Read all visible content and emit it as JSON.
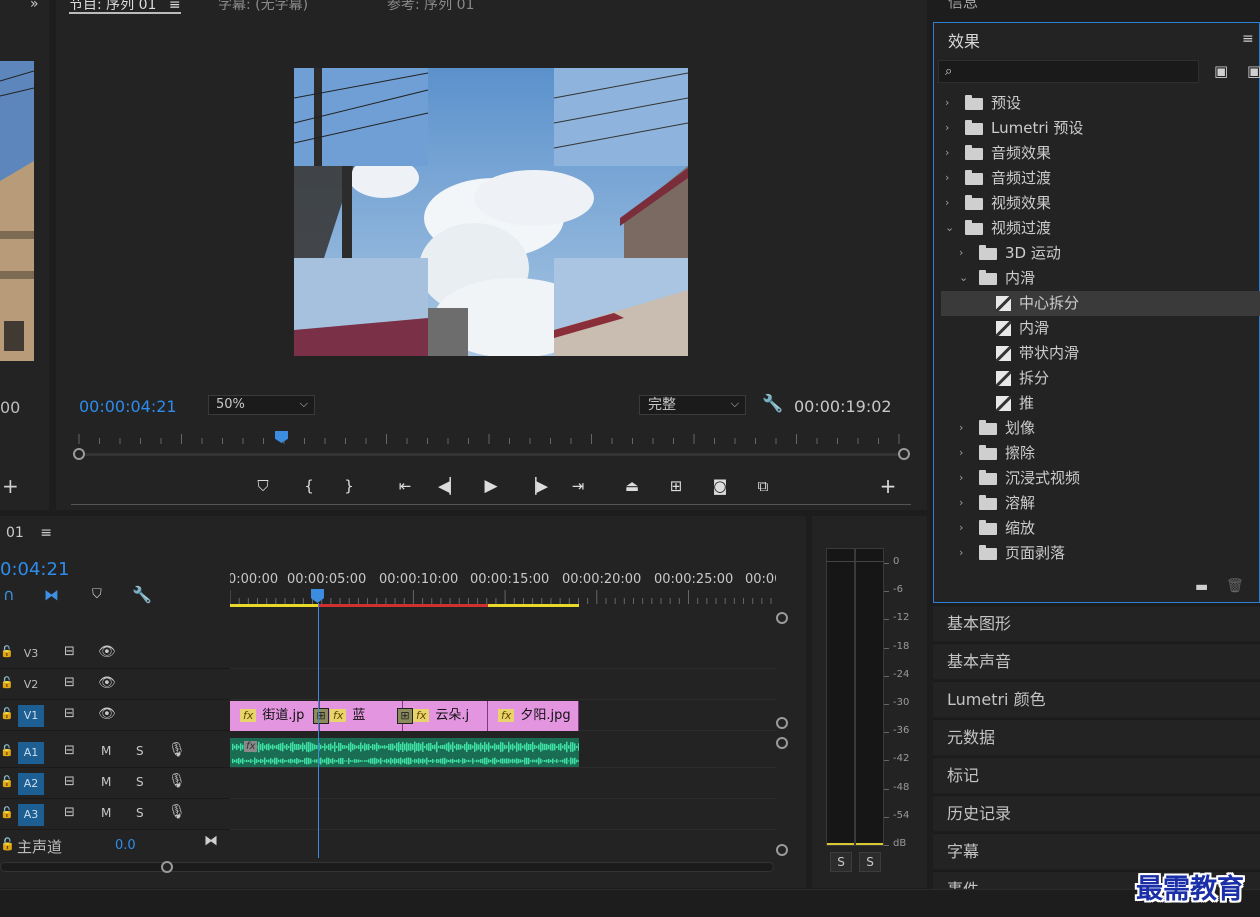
{
  "source_monitor": {
    "timecode_partial": "00"
  },
  "program_monitor": {
    "tabs": [
      "节目: 序列 01",
      "字幕: (无字幕)",
      "参考: 序列 01"
    ],
    "current_time": "00:00:04:21",
    "zoom": "50%",
    "quality": "完整",
    "duration": "00:00:19:02",
    "playhead_fraction": 0.25
  },
  "timeline": {
    "sequence_tab": "01",
    "current_time": "0:04:21",
    "ruler": [
      "0:00:00",
      "00:00:05:00",
      "00:00:10:00",
      "00:00:15:00",
      "00:00:20:00",
      "00:00:25:00",
      "00:00:"
    ],
    "tracks": [
      {
        "label": "V3"
      },
      {
        "label": "V2"
      },
      {
        "label": "V1",
        "m": "",
        "s": ""
      },
      {
        "label": "A1",
        "m": "M",
        "s": "S"
      },
      {
        "label": "A2",
        "m": "M",
        "s": "S"
      },
      {
        "label": "A3",
        "m": "M",
        "s": "S"
      }
    ],
    "master": {
      "label": "主声道",
      "value": "0.0"
    },
    "clips": [
      {
        "name": "街道.jp"
      },
      {
        "name": "蓝"
      },
      {
        "name": "云朵.j"
      },
      {
        "name": "夕阳.jpg"
      }
    ],
    "fx_badge": "fx"
  },
  "audio_meter": {
    "scale": [
      "0",
      "-6",
      "-12",
      "-18",
      "-24",
      "-30",
      "-36",
      "-42",
      "-48",
      "-54",
      "dB"
    ],
    "solo": [
      "S",
      "S"
    ]
  },
  "effects_panel": {
    "title": "效果",
    "search_placeholder": "",
    "tree": [
      {
        "label": "预设",
        "level": 0,
        "kind": "preset-folder",
        "expanded": false
      },
      {
        "label": "Lumetri 预设",
        "level": 0,
        "kind": "preset-folder",
        "expanded": false
      },
      {
        "label": "音频效果",
        "level": 0,
        "kind": "folder",
        "expanded": false
      },
      {
        "label": "音频过渡",
        "level": 0,
        "kind": "folder",
        "expanded": false
      },
      {
        "label": "视频效果",
        "level": 0,
        "kind": "folder",
        "expanded": false
      },
      {
        "label": "视频过渡",
        "level": 0,
        "kind": "folder",
        "expanded": true
      },
      {
        "label": "3D 运动",
        "level": 1,
        "kind": "folder",
        "expanded": false
      },
      {
        "label": "内滑",
        "level": 1,
        "kind": "folder",
        "expanded": true
      },
      {
        "label": "中心拆分",
        "level": 2,
        "kind": "transition",
        "selected": true
      },
      {
        "label": "内滑",
        "level": 2,
        "kind": "transition"
      },
      {
        "label": "带状内滑",
        "level": 2,
        "kind": "transition"
      },
      {
        "label": "拆分",
        "level": 2,
        "kind": "transition"
      },
      {
        "label": "推",
        "level": 2,
        "kind": "transition"
      },
      {
        "label": "划像",
        "level": 1,
        "kind": "folder",
        "expanded": false
      },
      {
        "label": "擦除",
        "level": 1,
        "kind": "folder",
        "expanded": false
      },
      {
        "label": "沉浸式视频",
        "level": 1,
        "kind": "folder",
        "expanded": false
      },
      {
        "label": "溶解",
        "level": 1,
        "kind": "folder",
        "expanded": false
      },
      {
        "label": "缩放",
        "level": 1,
        "kind": "folder",
        "expanded": false
      },
      {
        "label": "页面剥落",
        "level": 1,
        "kind": "folder",
        "expanded": false
      }
    ]
  },
  "side_panels": [
    "基本图形",
    "基本声音",
    "Lumetri 颜色",
    "元数据",
    "标记",
    "历史记录",
    "字幕",
    "事件"
  ],
  "info_tab": "信息",
  "watermark": "最需教育",
  "colors": {
    "accent": "#2d8ceb",
    "clip_video": "#e395e0",
    "clip_audio": "#2fb07f",
    "work_area_yellow": "#e8d82a",
    "render_red": "#d03030"
  }
}
